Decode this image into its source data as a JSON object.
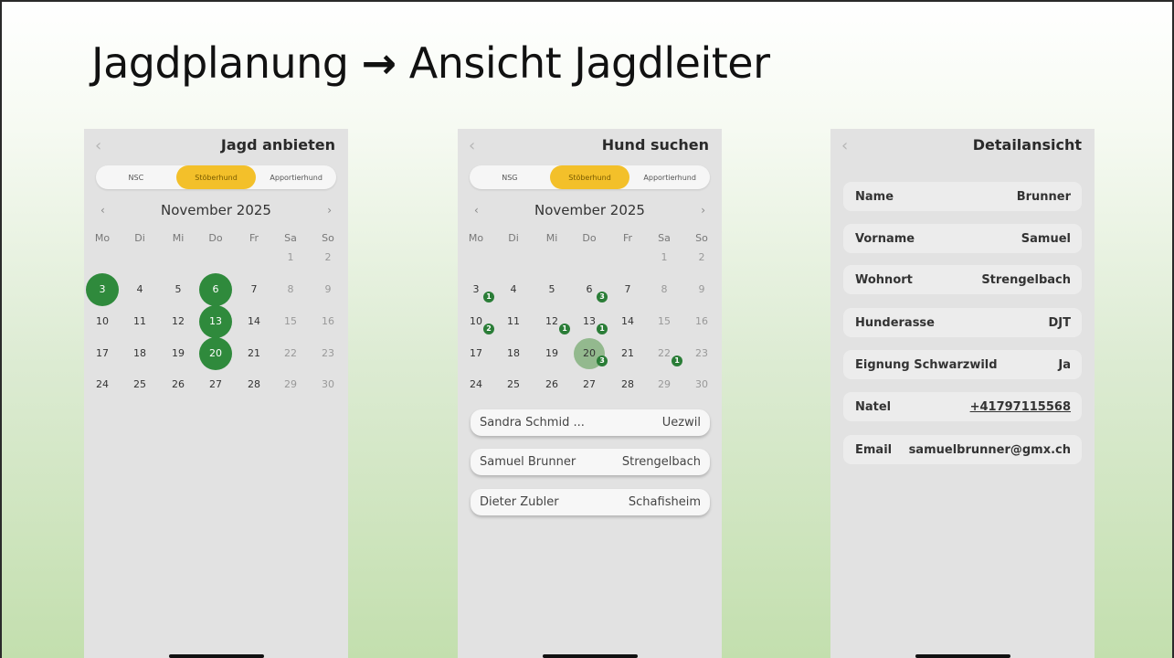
{
  "slide": {
    "title_left": "Jagdplanung",
    "arrow": "→",
    "title_right": "Ansicht Jagdleiter"
  },
  "screens": {
    "offer": {
      "back_icon": "‹",
      "title": "Jagd anbieten",
      "segments": [
        "NSC",
        "Stöberhund",
        "Apportierhund"
      ],
      "active_segment": "Stöberhund",
      "month": "November 2025",
      "prev": "‹",
      "next": "›",
      "weekdays": [
        "Mo",
        "Di",
        "Mi",
        "Do",
        "Fr",
        "Sa",
        "So"
      ],
      "rows": [
        [
          "",
          "",
          "",
          "",
          "",
          "1",
          "2"
        ],
        [
          "3",
          "4",
          "5",
          "6",
          "7",
          "8",
          "9"
        ],
        [
          "10",
          "11",
          "12",
          "13",
          "14",
          "15",
          "16"
        ],
        [
          "17",
          "18",
          "19",
          "20",
          "21",
          "22",
          "23"
        ],
        [
          "24",
          "25",
          "26",
          "27",
          "28",
          "29",
          "30"
        ]
      ],
      "highlighted_days": [
        "3",
        "6",
        "13",
        "20"
      ],
      "highlight_color": "#2f8a3c"
    },
    "search": {
      "back_icon": "‹",
      "title": "Hund suchen",
      "segments": [
        "NSG",
        "Stöberhund",
        "Apportierhund"
      ],
      "active_segment": "Stöberhund",
      "month": "November 2025",
      "prev": "‹",
      "next": "›",
      "weekdays": [
        "Mo",
        "Di",
        "Mi",
        "Do",
        "Fr",
        "Sa",
        "So"
      ],
      "rows": [
        [
          "",
          "",
          "",
          "",
          "",
          "1",
          "2"
        ],
        [
          "3",
          "4",
          "5",
          "6",
          "7",
          "8",
          "9"
        ],
        [
          "10",
          "11",
          "12",
          "13",
          "14",
          "15",
          "16"
        ],
        [
          "17",
          "18",
          "19",
          "20",
          "21",
          "22",
          "23"
        ],
        [
          "24",
          "25",
          "26",
          "27",
          "28",
          "29",
          "30"
        ]
      ],
      "badges": {
        "3": "1",
        "6": "3",
        "10": "2",
        "12": "1",
        "13": "1",
        "20": "3",
        "22": "1"
      },
      "selected_day": "20",
      "results": [
        {
          "name": "Sandra Schmid ...",
          "place": "Uezwil"
        },
        {
          "name": "Samuel Brunner",
          "place": "Strengelbach"
        },
        {
          "name": "Dieter Zubler",
          "place": "Schafisheim"
        }
      ],
      "accent_color": "#f3c02a"
    },
    "detail": {
      "back_icon": "‹",
      "title": "Detailansicht",
      "fields": [
        {
          "label": "Name",
          "value": "Brunner"
        },
        {
          "label": "Vorname",
          "value": "Samuel"
        },
        {
          "label": "Wohnort",
          "value": "Strengelbach"
        },
        {
          "label": "Hunderasse",
          "value": "DJT"
        },
        {
          "label": "Eignung Schwarzwild",
          "value": "Ja"
        },
        {
          "label": "Natel",
          "value": "+41797115568",
          "link": true
        },
        {
          "label": "Email",
          "value": "samuelbrunner@gmx.ch"
        }
      ]
    }
  }
}
